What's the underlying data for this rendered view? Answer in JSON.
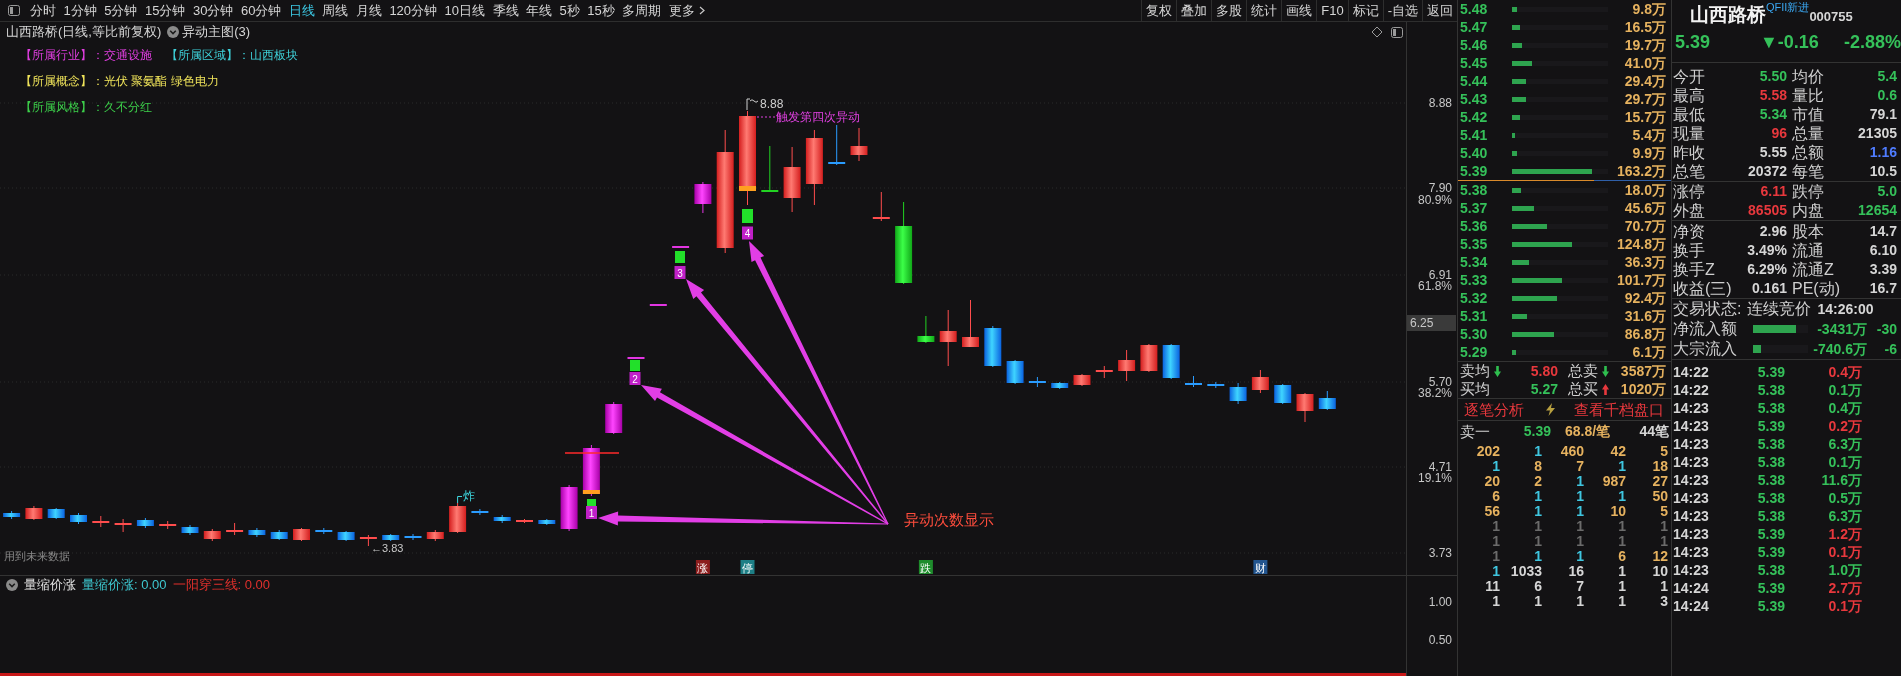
{
  "toolbar": {
    "periods": [
      {
        "label": "分时",
        "selected": false
      },
      {
        "label": "1分钟",
        "selected": false
      },
      {
        "label": "5分钟",
        "selected": false
      },
      {
        "label": "15分钟",
        "selected": false
      },
      {
        "label": "30分钟",
        "selected": false
      },
      {
        "label": "60分钟",
        "selected": false
      },
      {
        "label": "日线",
        "selected": true
      },
      {
        "label": "周线",
        "selected": false
      },
      {
        "label": "月线",
        "selected": false
      },
      {
        "label": "120分钟",
        "selected": false
      },
      {
        "label": "10日线",
        "selected": false
      },
      {
        "label": "季线",
        "selected": false
      },
      {
        "label": "年线",
        "selected": false
      },
      {
        "label": "5秒",
        "selected": false
      },
      {
        "label": "15秒",
        "selected": false
      },
      {
        "label": "多周期",
        "selected": false
      }
    ],
    "more": "更多",
    "tools": [
      "复权",
      "叠加",
      "多股",
      "统计",
      "画线",
      "F10",
      "标记",
      "-自选",
      "返回"
    ]
  },
  "chart": {
    "title": "山西路桥(日线,等比前复权)",
    "indicator": "异动主图(3)",
    "tag_lines": [
      [
        {
          "text": "【所属行业】：交通设施",
          "color": "#e03ee0"
        },
        {
          "text": "【所属区域】：山西板块",
          "color": "#3ed0d8"
        }
      ],
      [
        {
          "text": "【所属概念】：光伏 聚氨酯 绿色电力",
          "color": "#f0e45a"
        }
      ],
      [
        {
          "text": "【所属风格】：久不分红",
          "color": "#3ccf4a"
        }
      ]
    ],
    "annotations": {
      "high": "8.88",
      "trigger": "触发第四次异动",
      "burst": "炸",
      "low": "←3.83",
      "callout": "异动次数显示"
    },
    "signals": [
      {
        "count": "1"
      },
      {
        "count": "2"
      },
      {
        "count": "3"
      },
      {
        "count": "4"
      }
    ],
    "notice": "用到未来数据",
    "event_marks": [
      {
        "text": "涨",
        "color": "#8c1d1d"
      },
      {
        "text": "停",
        "color": "#1d7f86"
      },
      {
        "text": "跌",
        "color": "#1e8c2c"
      },
      {
        "text": "财",
        "color": "#23558f"
      }
    ],
    "price_axis": [
      {
        "value": "8.88"
      },
      {
        "value": "7.90",
        "percent": "80.9%"
      },
      {
        "value": "6.91",
        "percent": "61.8%"
      },
      {
        "value": "5.70",
        "percent": "38.2%"
      },
      {
        "value": "4.71",
        "percent": "19.1%"
      },
      {
        "value": "3.73"
      }
    ],
    "cursor_price": "6.25"
  },
  "sub_chart": {
    "name": "量缩价涨",
    "readings": [
      {
        "text": "量缩价涨: 0.00",
        "color": "#3ec8d0"
      },
      {
        "text": "一阳穿三线: 0.00",
        "color": "#e0302c"
      }
    ],
    "axis": [
      "1.00",
      "0.50"
    ]
  },
  "order_book": {
    "asks": [
      {
        "price": "5.48",
        "volume": "9.8万",
        "level": 0.05
      },
      {
        "price": "5.47",
        "volume": "16.5万",
        "level": 0.08
      },
      {
        "price": "5.46",
        "volume": "19.7万",
        "level": 0.1
      },
      {
        "price": "5.45",
        "volume": "41.0万",
        "level": 0.21
      },
      {
        "price": "5.44",
        "volume": "29.4万",
        "level": 0.15
      },
      {
        "price": "5.43",
        "volume": "29.7万",
        "level": 0.15
      },
      {
        "price": "5.42",
        "volume": "15.7万",
        "level": 0.08
      },
      {
        "price": "5.41",
        "volume": "5.4万",
        "level": 0.03
      },
      {
        "price": "5.40",
        "volume": "9.9万",
        "level": 0.05
      },
      {
        "price": "5.39",
        "volume": "163.2万",
        "level": 0.83
      }
    ],
    "bids": [
      {
        "price": "5.38",
        "volume": "18.0万",
        "level": 0.09
      },
      {
        "price": "5.37",
        "volume": "45.6万",
        "level": 0.23
      },
      {
        "price": "5.36",
        "volume": "70.7万",
        "level": 0.36
      },
      {
        "price": "5.35",
        "volume": "124.8万",
        "level": 0.63
      },
      {
        "price": "5.34",
        "volume": "36.3万",
        "level": 0.18
      },
      {
        "price": "5.33",
        "volume": "101.7万",
        "level": 0.52
      },
      {
        "price": "5.32",
        "volume": "92.4万",
        "level": 0.47
      },
      {
        "price": "5.31",
        "volume": "31.6万",
        "level": 0.16
      },
      {
        "price": "5.30",
        "volume": "86.8万",
        "level": 0.44
      },
      {
        "price": "5.29",
        "volume": "6.1万",
        "level": 0.04
      }
    ],
    "summary": [
      {
        "label": "卖均",
        "arrow": {
          "kind": "down",
          "color": "#2fbf4f"
        },
        "price": {
          "text": "5.80",
          "color": "#e8383d"
        },
        "total_label": "总卖",
        "total_arrow": {
          "kind": "down",
          "color": "#2fbf4f"
        },
        "total": "3587万"
      },
      {
        "label": "买均",
        "price": {
          "text": "5.27",
          "color": "#35c15a"
        },
        "total_label": "总买",
        "total_arrow": {
          "kind": "up",
          "color": "#e8383d"
        },
        "total": "1020万"
      }
    ],
    "links": [
      "逐笔分析",
      "查看千档盘口"
    ],
    "best_ask": {
      "label": "卖一",
      "price": "5.39",
      "average": "68.8/笔",
      "count": "44笔"
    },
    "queue": [
      [
        {
          "text": "202",
          "color": "#e6b25f"
        },
        {
          "text": "1",
          "color": "#3fc6e0"
        },
        {
          "text": "460",
          "color": "#e6b25f"
        },
        {
          "text": "42",
          "color": "#e6b25f"
        },
        {
          "text": "5",
          "color": "#e6b25f"
        }
      ],
      [
        {
          "text": "1",
          "color": "#3fc6e0"
        },
        {
          "text": "8",
          "color": "#e6b25f"
        },
        {
          "text": "7",
          "color": "#e6b25f"
        },
        {
          "text": "1",
          "color": "#3fc6e0"
        },
        {
          "text": "18",
          "color": "#e6b25f"
        }
      ],
      [
        {
          "text": "20",
          "color": "#e6b25f"
        },
        {
          "text": "2",
          "color": "#e6b25f"
        },
        {
          "text": "1",
          "color": "#3fc6e0"
        },
        {
          "text": "987",
          "color": "#e6b25f"
        },
        {
          "text": "27",
          "color": "#e6b25f"
        }
      ],
      [
        {
          "text": "6",
          "color": "#e6b25f"
        },
        {
          "text": "1",
          "color": "#3fc6e0"
        },
        {
          "text": "1",
          "color": "#3fc6e0"
        },
        {
          "text": "1",
          "color": "#3fc6e0"
        },
        {
          "text": "50",
          "color": "#e6b25f"
        }
      ],
      [
        {
          "text": "56",
          "color": "#e6b25f"
        },
        {
          "text": "1",
          "color": "#3fc6e0"
        },
        {
          "text": "1",
          "color": "#3fc6e0"
        },
        {
          "text": "10",
          "color": "#e6b25f"
        },
        {
          "text": "5",
          "color": "#e6b25f"
        }
      ],
      [
        {
          "text": "1",
          "color": "#6b6b6b"
        },
        {
          "text": "1",
          "color": "#6b6b6b"
        },
        {
          "text": "1",
          "color": "#6b6b6b"
        },
        {
          "text": "1",
          "color": "#6b6b6b"
        },
        {
          "text": "1",
          "color": "#6b6b6b"
        }
      ],
      [
        {
          "text": "1",
          "color": "#6b6b6b"
        },
        {
          "text": "1",
          "color": "#6b6b6b"
        },
        {
          "text": "1",
          "color": "#6b6b6b"
        },
        {
          "text": "1",
          "color": "#6b6b6b"
        },
        {
          "text": "1",
          "color": "#6b6b6b"
        }
      ],
      [
        {
          "text": "1",
          "color": "#6b6b6b"
        },
        {
          "text": "1",
          "color": "#3fc6e0"
        },
        {
          "text": "1",
          "color": "#3fc6e0"
        },
        {
          "text": "6",
          "color": "#e6b25f"
        },
        {
          "text": "12",
          "color": "#e6b25f"
        }
      ],
      [
        {
          "text": "1",
          "color": "#3fc6e0"
        },
        {
          "text": "1033",
          "color": "#d6d6d6"
        },
        {
          "text": "16",
          "color": "#d6d6d6"
        },
        {
          "text": "1",
          "color": "#d6d6d6"
        },
        {
          "text": "10",
          "color": "#d6d6d6"
        }
      ],
      [
        {
          "text": "11",
          "color": "#d6d6d6"
        },
        {
          "text": "6",
          "color": "#d6d6d6"
        },
        {
          "text": "7",
          "color": "#d6d6d6"
        },
        {
          "text": "1",
          "color": "#d6d6d6"
        },
        {
          "text": "1",
          "color": "#d6d6d6"
        }
      ],
      [
        {
          "text": "1",
          "color": "#d6d6d6"
        },
        {
          "text": "1",
          "color": "#d6d6d6"
        },
        {
          "text": "1",
          "color": "#d6d6d6"
        },
        {
          "text": "1",
          "color": "#d6d6d6"
        },
        {
          "text": "3",
          "color": "#d6d6d6"
        }
      ]
    ]
  },
  "quote": {
    "name": "山西路桥",
    "note": "QFII新进",
    "code": "000755",
    "price": {
      "text": "5.39",
      "color": "#35c15a"
    },
    "change": {
      "text": "▼-0.16",
      "color": "#35c15a"
    },
    "change_pct": {
      "text": "-2.88%",
      "color": "#35c15a"
    },
    "stat_groups": [
      [
        {
          "left": {
            "label": "今开",
            "value": "5.50",
            "color": "#35c15a"
          },
          "right": {
            "label": "均价",
            "value": "5.4",
            "color": "#35c15a"
          }
        },
        {
          "left": {
            "label": "最高",
            "value": "5.58",
            "color": "#e8383d"
          },
          "right": {
            "label": "量比",
            "value": "0.6",
            "color": "#35c15a"
          }
        },
        {
          "left": {
            "label": "最低",
            "value": "5.34",
            "color": "#35c15a"
          },
          "right": {
            "label": "市值",
            "value": "79.1",
            "color": "#d6d6d6"
          }
        },
        {
          "left": {
            "label": "现量",
            "value": "96",
            "color": "#e8383d"
          },
          "right": {
            "label": "总量",
            "value": "21305",
            "color": "#d6d6d6"
          }
        },
        {
          "left": {
            "label": "昨收",
            "value": "5.55",
            "color": "#d6d6d6"
          },
          "right": {
            "label": "总额",
            "value": "1.16",
            "color": "#4f7cff"
          }
        },
        {
          "left": {
            "label": "总笔",
            "value": "20372",
            "color": "#d6d6d6"
          },
          "right": {
            "label": "每笔",
            "value": "10.5",
            "color": "#d6d6d6"
          }
        }
      ],
      [
        {
          "left": {
            "label": "涨停",
            "value": "6.11",
            "color": "#e8383d"
          },
          "right": {
            "label": "跌停",
            "value": "5.0",
            "color": "#35c15a"
          }
        },
        {
          "left": {
            "label": "外盘",
            "value": "86505",
            "color": "#e8383d"
          },
          "right": {
            "label": "内盘",
            "value": "12654",
            "color": "#35c15a"
          }
        }
      ],
      [
        {
          "left": {
            "label": "净资",
            "value": "2.96",
            "color": "#d6d6d6"
          },
          "right": {
            "label": "股本",
            "value": "14.7",
            "color": "#d6d6d6"
          }
        },
        {
          "left": {
            "label": "换手",
            "value": "3.49%",
            "color": "#d6d6d6"
          },
          "right": {
            "label": "流通",
            "value": "6.10",
            "color": "#d6d6d6"
          }
        },
        {
          "left": {
            "label": "换手Z",
            "value": "6.29%",
            "color": "#d6d6d6"
          },
          "right": {
            "label": "流通Z",
            "value": "3.39",
            "color": "#d6d6d6"
          }
        },
        {
          "left": {
            "label": "收益(三)",
            "value": "0.161",
            "color": "#d6d6d6"
          },
          "right": {
            "label": "PE(动)",
            "value": "16.7",
            "color": "#d6d6d6"
          }
        }
      ]
    ],
    "trade_status": {
      "label": "交易状态:",
      "value": "连续竞价",
      "time": "14:26:00"
    },
    "flows": [
      {
        "label": "净流入额",
        "level": 0.78,
        "amount": "-3431万",
        "ratio": "-30"
      },
      {
        "label": "大宗流入",
        "level": 0.15,
        "amount": "-740.6万",
        "ratio": "-6"
      }
    ],
    "ticks": [
      {
        "time": "14:22",
        "price": "5.39",
        "volume": "0.4万",
        "color": "#e8383d"
      },
      {
        "time": "14:22",
        "price": "5.38",
        "volume": "0.1万",
        "color": "#35c15a"
      },
      {
        "time": "14:23",
        "price": "5.38",
        "volume": "0.4万",
        "color": "#35c15a"
      },
      {
        "time": "14:23",
        "price": "5.39",
        "volume": "0.2万",
        "color": "#e8383d"
      },
      {
        "time": "14:23",
        "price": "5.38",
        "volume": "6.3万",
        "color": "#35c15a"
      },
      {
        "time": "14:23",
        "price": "5.38",
        "volume": "0.1万",
        "color": "#35c15a"
      },
      {
        "time": "14:23",
        "price": "5.38",
        "volume": "11.6万",
        "color": "#35c15a"
      },
      {
        "time": "14:23",
        "price": "5.38",
        "volume": "0.5万",
        "color": "#35c15a"
      },
      {
        "time": "14:23",
        "price": "5.38",
        "volume": "6.3万",
        "color": "#35c15a"
      },
      {
        "time": "14:23",
        "price": "5.39",
        "volume": "1.2万",
        "color": "#e8383d"
      },
      {
        "time": "14:23",
        "price": "5.39",
        "volume": "0.1万",
        "color": "#e8383d"
      },
      {
        "time": "14:23",
        "price": "5.38",
        "volume": "1.0万",
        "color": "#35c15a"
      },
      {
        "time": "14:24",
        "price": "5.39",
        "volume": "2.7万",
        "color": "#e8383d"
      },
      {
        "time": "14:24",
        "price": "5.39",
        "volume": "0.1万",
        "color": "#e8383d"
      }
    ]
  }
}
